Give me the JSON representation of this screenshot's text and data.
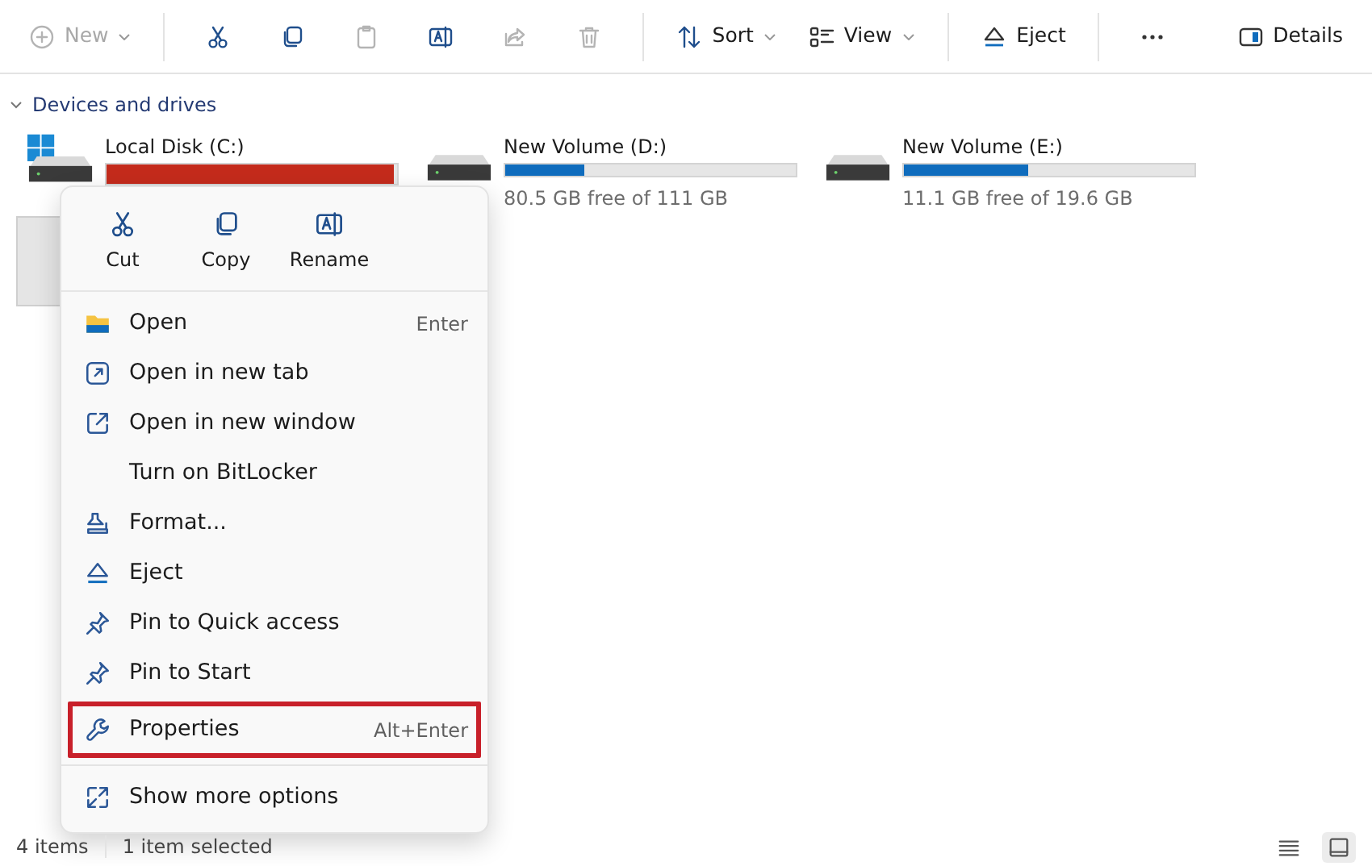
{
  "toolbar": [
    {
      "kind": "button",
      "label": "New",
      "disabled": true
    },
    {
      "kind": "sep"
    },
    {
      "kind": "button",
      "disabled": false
    },
    {
      "kind": "button",
      "disabled": false
    },
    {
      "kind": "button",
      "disabled": true
    },
    {
      "kind": "button",
      "disabled": false
    },
    {
      "kind": "button",
      "disabled": true
    },
    {
      "kind": "button",
      "disabled": true
    },
    {
      "kind": "sep"
    },
    {
      "kind": "button",
      "label": "Sort",
      "disabled": false
    },
    {
      "kind": "button",
      "label": "View",
      "disabled": false
    },
    {
      "kind": "sep"
    },
    {
      "kind": "button",
      "label": "Eject",
      "disabled": false
    },
    {
      "kind": "sep"
    },
    {
      "kind": "button",
      "disabled": false
    },
    {
      "kind": "spacer"
    },
    {
      "kind": "button",
      "label": "Details",
      "disabled": false
    }
  ],
  "section": {
    "title": "Devices and drives",
    "expanded": true
  },
  "drives": [
    {
      "kind": "system",
      "name": "Local Disk (C:)",
      "level": 0.99,
      "color": "#c42b1c",
      "selected": false
    },
    {
      "kind": "drive",
      "name": "New Volume (D:)",
      "level": 0.27,
      "color": "#0f6cbd",
      "free": "80.5 GB free of 111 GB",
      "selected": false
    },
    {
      "kind": "drive",
      "name": "New Volume (E:)",
      "level": 0.43,
      "color": "#0f6cbd",
      "free": "11.1 GB free of 19.6 GB",
      "selected": false
    },
    {
      "selected": true
    }
  ],
  "context_menu": {
    "quick_actions": [
      {
        "label": "Cut"
      },
      {
        "label": "Copy"
      },
      {
        "label": "Rename"
      }
    ],
    "items": [
      {
        "kind": "item",
        "label": "Open",
        "shortcut": "Enter",
        "highlighted": false
      },
      {
        "kind": "item",
        "label": "Open in new tab",
        "highlighted": false
      },
      {
        "kind": "item",
        "label": "Open in new window",
        "highlighted": false
      },
      {
        "kind": "item",
        "label": "Turn on BitLocker",
        "highlighted": false
      },
      {
        "kind": "item",
        "label": "Format...",
        "highlighted": false
      },
      {
        "kind": "item",
        "label": "Eject",
        "highlighted": false
      },
      {
        "kind": "item",
        "label": "Pin to Quick access",
        "highlighted": false
      },
      {
        "kind": "item",
        "label": "Pin to Start",
        "highlighted": false
      },
      {
        "kind": "item",
        "label": "Properties",
        "shortcut": "Alt+Enter",
        "highlighted": true
      },
      {
        "kind": "separator"
      },
      {
        "kind": "item",
        "label": "Show more options",
        "highlighted": false
      }
    ]
  },
  "status_bar": {
    "items_count": "4 items",
    "selection": "1 item selected",
    "views": [
      {
        "selected": false
      },
      {
        "selected": true
      }
    ]
  }
}
